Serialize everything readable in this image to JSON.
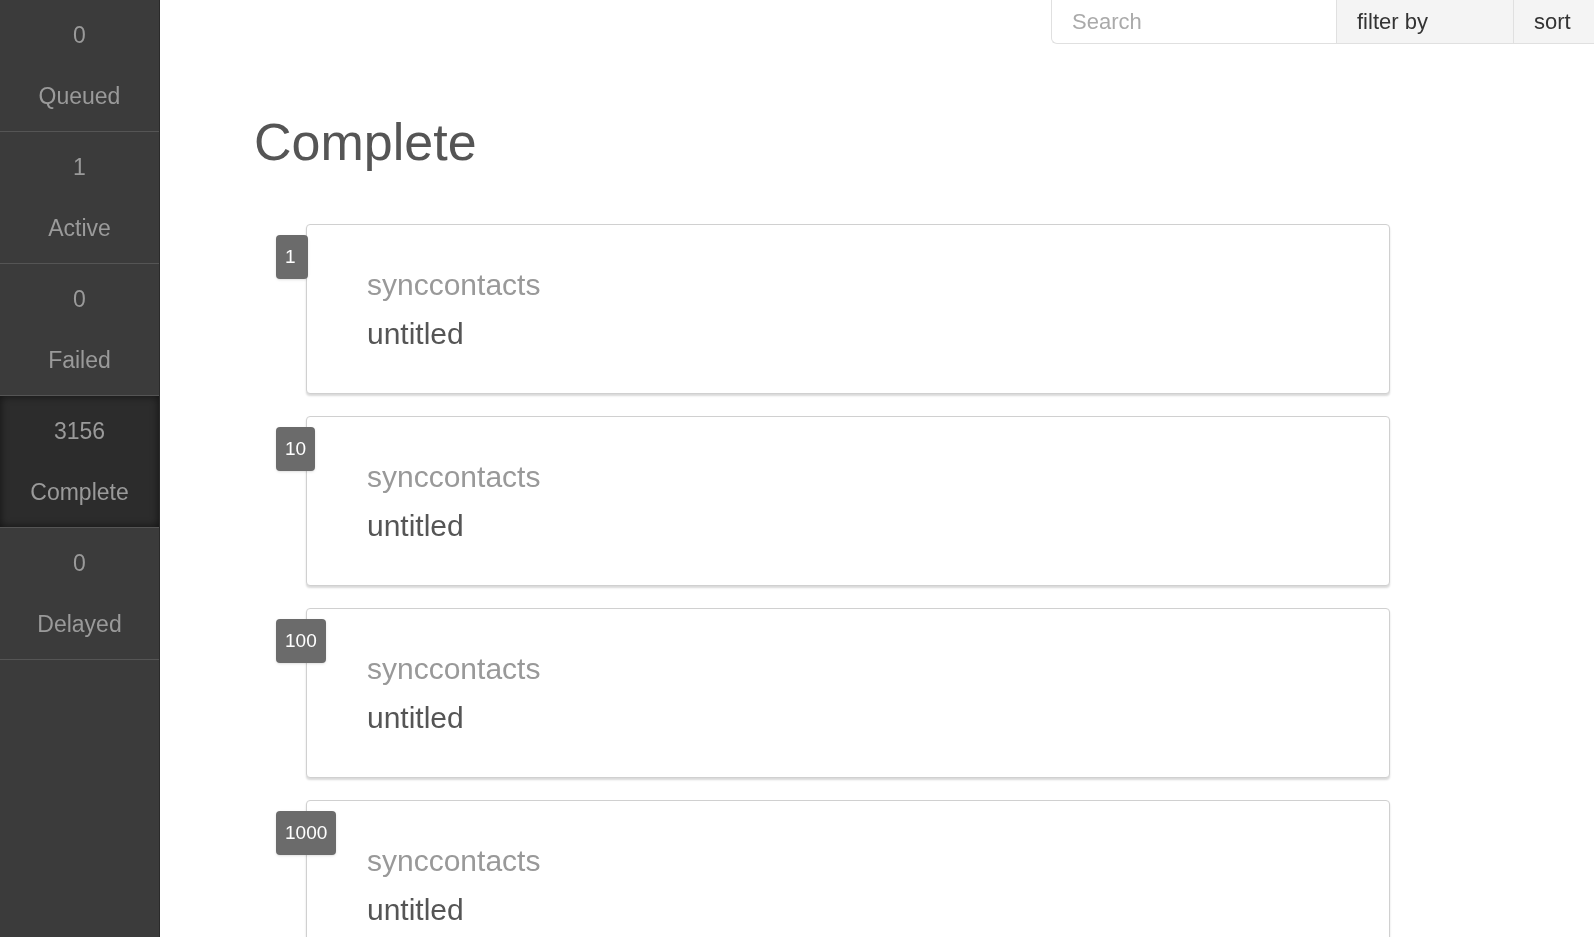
{
  "sidebar": {
    "items": [
      {
        "count": "0",
        "label": "Queued",
        "selected": false
      },
      {
        "count": "1",
        "label": "Active",
        "selected": false
      },
      {
        "count": "0",
        "label": "Failed",
        "selected": false
      },
      {
        "count": "3156",
        "label": "Complete",
        "selected": true
      },
      {
        "count": "0",
        "label": "Delayed",
        "selected": false
      }
    ]
  },
  "toolbar": {
    "search": {
      "placeholder": "Search"
    },
    "filter": "filter by",
    "sort": "sort"
  },
  "heading": "Complete",
  "jobs": [
    {
      "id": "1",
      "type": "synccontacts",
      "title": "untitled"
    },
    {
      "id": "10",
      "type": "synccontacts",
      "title": "untitled"
    },
    {
      "id": "100",
      "type": "synccontacts",
      "title": "untitled"
    },
    {
      "id": "1000",
      "type": "synccontacts",
      "title": "untitled"
    }
  ]
}
